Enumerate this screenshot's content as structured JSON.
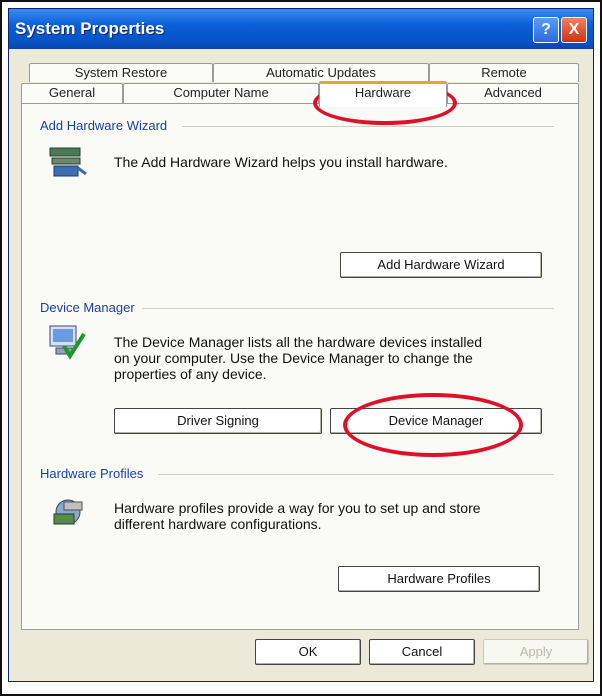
{
  "window": {
    "title": "System Properties",
    "help_icon": "?",
    "close_icon": "X"
  },
  "tabs": {
    "back_row": [
      "System Restore",
      "Automatic Updates",
      "Remote"
    ],
    "front_row": [
      "General",
      "Computer Name",
      "Hardware",
      "Advanced"
    ],
    "selected": "Hardware"
  },
  "add_hardware": {
    "title": "Add Hardware Wizard",
    "description": "The Add Hardware Wizard helps you install hardware.",
    "button": "Add Hardware Wizard",
    "icon": "hardware-wizard-icon"
  },
  "device_manager": {
    "title": "Device Manager",
    "description_lines": [
      "The Device Manager lists all the hardware devices installed",
      "on your computer. Use the Device Manager to change the",
      "properties of any device."
    ],
    "driver_button": "Driver Signing",
    "button": "Device Manager",
    "icon": "device-manager-icon"
  },
  "hardware_profiles": {
    "title": "Hardware Profiles",
    "description_lines": [
      "Hardware profiles provide a way for you to set up and store",
      "different hardware configurations."
    ],
    "button": "Hardware Profiles",
    "icon": "hardware-profiles-icon"
  },
  "footer": {
    "ok": "OK",
    "cancel": "Cancel",
    "apply": "Apply"
  },
  "colors": {
    "titlebar": "#0751c4",
    "dialog_bg": "#ece9d8",
    "group_title": "#1b3fa8",
    "highlight_ring": "#e0102a"
  }
}
